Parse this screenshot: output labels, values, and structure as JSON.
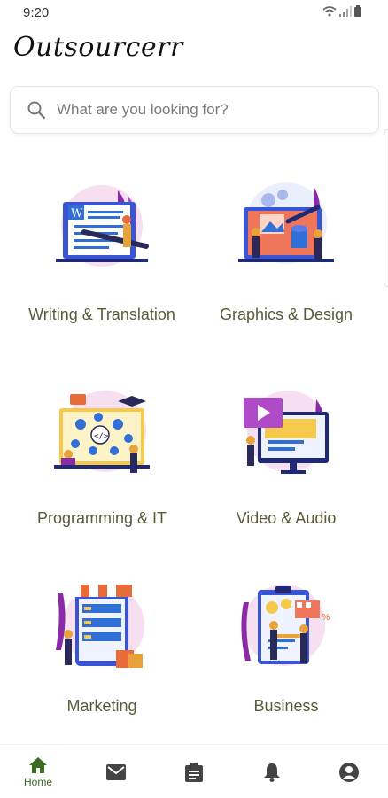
{
  "status_bar": {
    "time": "9:20"
  },
  "app": {
    "logo_text": "Outsourcerr"
  },
  "search": {
    "placeholder": "What are you looking for?"
  },
  "categories": [
    {
      "label": "Writing & Translation",
      "icon": "writing-illustration"
    },
    {
      "label": "Graphics & Design",
      "icon": "design-illustration"
    },
    {
      "label": "Programming & IT",
      "icon": "programming-illustration"
    },
    {
      "label": "Video & Audio",
      "icon": "video-illustration"
    },
    {
      "label": "Marketing",
      "icon": "marketing-illustration"
    },
    {
      "label": "Business",
      "icon": "business-illustration"
    }
  ],
  "bottom_nav": {
    "home_label": "Home",
    "items": [
      "home-icon",
      "mail-icon",
      "clipboard-icon",
      "bell-icon",
      "account-icon"
    ]
  },
  "colors": {
    "accent": "#3a6b1f",
    "label": "#5a5a3a",
    "purple": "#7b2fa6",
    "blue": "#2f6fd6",
    "orange": "#e86b3a"
  }
}
